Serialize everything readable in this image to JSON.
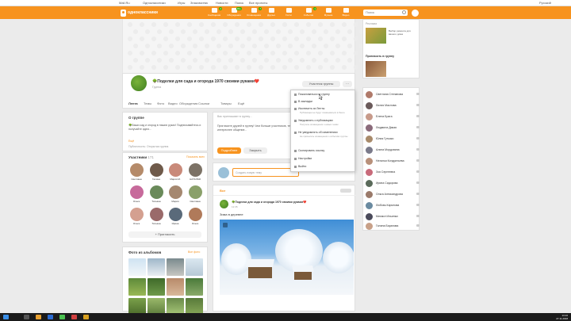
{
  "topbar": {
    "items": [
      "Mail.Ru",
      "Одноклассники",
      "Игры",
      "Знакомства",
      "Новости",
      "Поиск",
      "Все проекты"
    ],
    "right": "Русский"
  },
  "header": {
    "logo_text": "одноклассники",
    "nav": [
      {
        "label": "Сообщения",
        "badge": "2"
      },
      {
        "label": "Обсуждения",
        "badge": "99+"
      },
      {
        "label": "Оповещения",
        "badge": "7"
      },
      {
        "label": "Друзья",
        "badge": ""
      },
      {
        "label": "Гости",
        "badge": ""
      },
      {
        "label": "События",
        "badge": "1"
      },
      {
        "label": "Музыка",
        "badge": ""
      },
      {
        "label": "Видео",
        "badge": ""
      },
      {
        "label": "Музыка",
        "badge": ""
      },
      {
        "label": "Игры",
        "badge": ""
      }
    ],
    "search_placeholder": "Поиск"
  },
  "group": {
    "title": "🌳Поделки для сада и огорода 1970 своими руками❤️",
    "subtitle": "Группа",
    "member_button": "Участник группы",
    "more_button": "···",
    "tabs": [
      "Лента",
      "Темы",
      "Фото",
      "Видео",
      "Обсуждения",
      "Ссылки",
      "Товары",
      "Ещё"
    ]
  },
  "about": {
    "heading": "О группе",
    "text": "🌳Ваши сад и огород в наших руках! Подписывайтесь и получайте идеи...",
    "link": "Ещё",
    "meta": "Публичность: Открытая группа"
  },
  "members": {
    "heading": "Участники",
    "count": "171",
    "link": "Показать всех",
    "names": [
      "Светлана",
      "Галина",
      "Мария М.",
      "НАТАЛЬЯ",
      "Ольга",
      "Татьяна",
      "Мария",
      "Светлана",
      "Ольга",
      "Татьяна",
      "Ирина",
      "Ольга"
    ],
    "invite_button": "Пригласить"
  },
  "photos": {
    "heading": "Фото из альбомов",
    "link": "Все фото"
  },
  "notice": {
    "text": "Вас приглашают в группу..."
  },
  "invite": {
    "text": "Пригласите друзей в группу! Чем больше участников, тем интереснее общение...",
    "accept": "Подробнее",
    "decline": "Закрыть"
  },
  "composer": {
    "placeholder": "Создать новую тему"
  },
  "feed": {
    "tab": "Все",
    "post_author": "🌳Поделки для сада и огорода 1970 своими руками❤️",
    "post_time": "12:35",
    "post_text": "Зима в деревне"
  },
  "menu": {
    "items": [
      {
        "label": "Пожаловаться на группу",
        "sub": ""
      },
      {
        "label": "В закладки",
        "sub": ""
      },
      {
        "label": "Исключить из Ленты",
        "sub": "Публикации не будут показываться в Ленте"
      },
      {
        "label": "Уведомлять о публикациях",
        "sub": "Получать оповещения о новых темах"
      },
      {
        "label": "Не уведомлять об изменениях",
        "sub": "Не присылать оповещения о событиях группы"
      },
      {
        "label": "Скопировать ссылку",
        "sub": ""
      },
      {
        "label": "Настройки",
        "sub": ""
      },
      {
        "label": "Выйти",
        "sub": ""
      }
    ]
  },
  "right": {
    "ad_title": "Реклама",
    "ad_text": "Выбор ремонта для вашего дома",
    "promo_title": "Пригласить в группу",
    "friends": [
      "Светлана Степанова",
      "Лилия Маслова",
      "Елена Брага",
      "Людмила Дикая",
      "Юлия Гутьяко",
      "Алина Мордовина",
      "Наталья Кондратьева",
      "Зоя Сергеевна",
      "Ирина Сидорова",
      "Ольга Александрова",
      "Любовь Кирилова",
      "Михаил Ильиных",
      "Галина Баранова"
    ]
  },
  "taskbar": {
    "time": "13:16",
    "date": "27.11.2018"
  },
  "colors": {
    "accent": "#f7931e",
    "background": "#ebebeb"
  }
}
